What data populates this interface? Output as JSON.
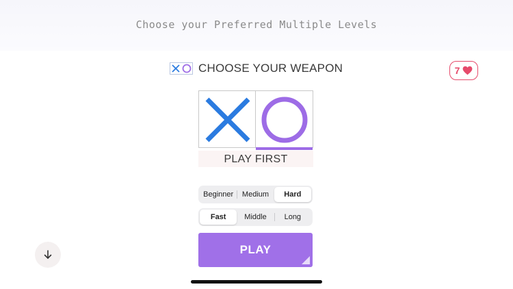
{
  "banner": {
    "text": "Choose your Preferred Multiple Levels"
  },
  "header": {
    "title": "CHOOSE YOUR WEAPON"
  },
  "lives": {
    "count": "7",
    "icon": "heart-icon",
    "color": "#e64a6b"
  },
  "weapons": {
    "selected": "o",
    "x_color": "#2b7be0",
    "o_color": "#9d6ce6"
  },
  "play_first": {
    "label": "PLAY FIRST"
  },
  "level": {
    "options": [
      "Beginner",
      "Medium",
      "Hard"
    ],
    "selected": "Hard"
  },
  "speed": {
    "options": [
      "Fast",
      "Middle",
      "Long"
    ],
    "selected": "Fast"
  },
  "play_button": {
    "label": "PLAY",
    "color": "#a070e8"
  },
  "scroll_button": {
    "icon": "arrow-down-icon"
  }
}
